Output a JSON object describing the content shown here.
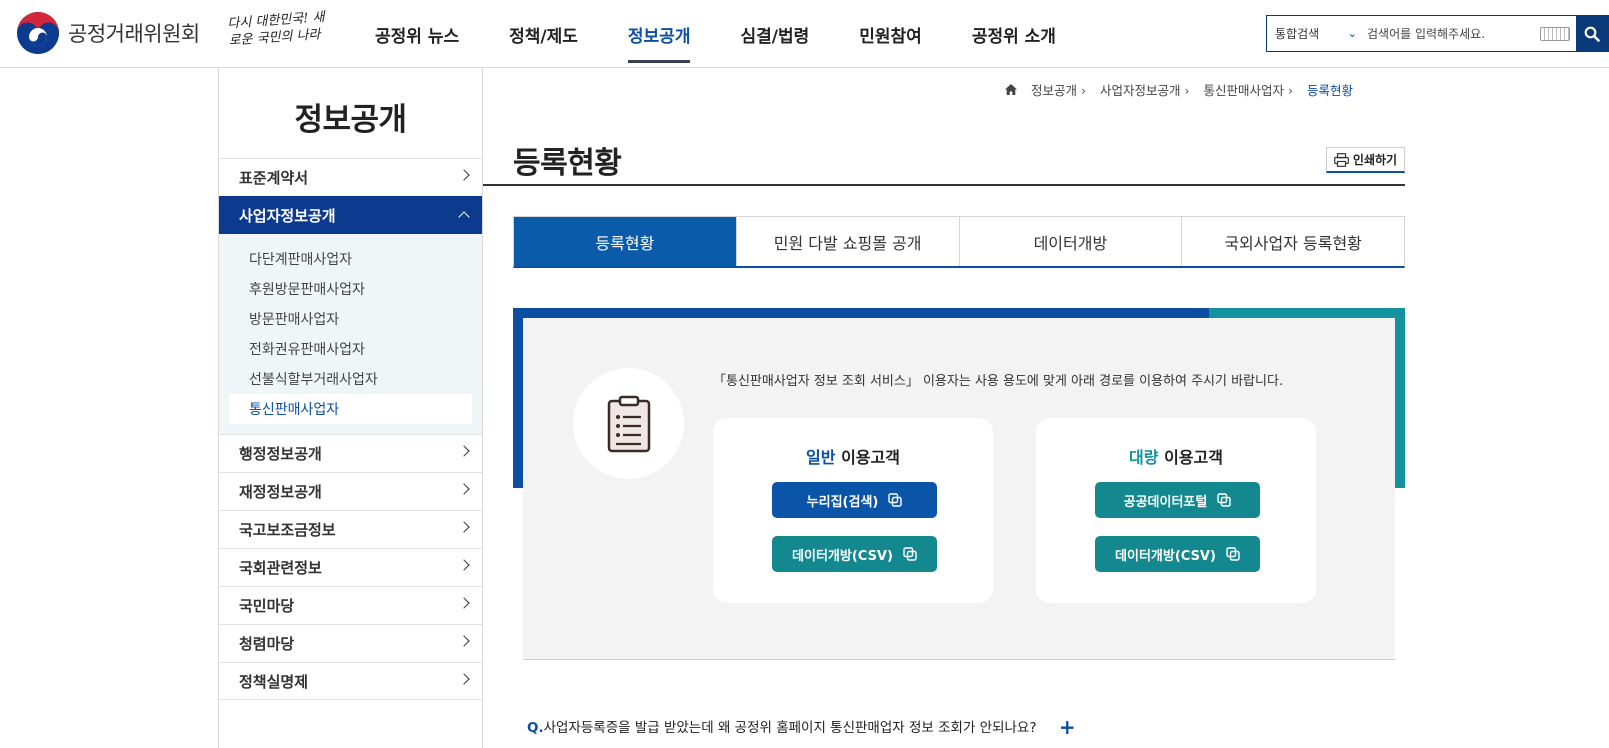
{
  "header": {
    "logo_text": "공정거래위원회",
    "slogan": "다시 대한민국! 새로운 국민의 나라",
    "nav": [
      {
        "label": "공정위 뉴스"
      },
      {
        "label": "정책/제도"
      },
      {
        "label": "정보공개",
        "active": true
      },
      {
        "label": "심결/법령"
      },
      {
        "label": "민원참여"
      },
      {
        "label": "공정위 소개"
      }
    ],
    "search": {
      "scope": "통합검색",
      "placeholder": "검색어를 입력해주세요.",
      "button_icon": "search-icon"
    }
  },
  "sidebar": {
    "title": "정보공개",
    "items": [
      {
        "label": "표준계약서"
      },
      {
        "label": "사업자정보공개",
        "open": true
      },
      {
        "label": "행정정보공개"
      },
      {
        "label": "재정정보공개"
      },
      {
        "label": "국고보조금정보"
      },
      {
        "label": "국회관련정보"
      },
      {
        "label": "국민마당"
      },
      {
        "label": "청렴마당"
      },
      {
        "label": "정책실명제"
      }
    ],
    "sub_items": [
      {
        "label": "다단계판매사업자"
      },
      {
        "label": "후원방문판매사업자"
      },
      {
        "label": "방문판매사업자"
      },
      {
        "label": "전화권유판매사업자"
      },
      {
        "label": "선불식할부거래사업자"
      },
      {
        "label": "통신판매사업자",
        "active": true
      }
    ]
  },
  "breadcrumb": [
    "정보공개",
    "사업자정보공개",
    "통신판매사업자",
    "등록현황"
  ],
  "page": {
    "title": "등록현황",
    "print_label": "인쇄하기"
  },
  "tabs": [
    {
      "label": "등록현황",
      "active": true
    },
    {
      "label": "민원 다발 쇼핑몰 공개"
    },
    {
      "label": "데이터개방"
    },
    {
      "label": "국외사업자 등록현황"
    }
  ],
  "panel": {
    "notice": "「통신판매사업자 정보 조회 서비스」 이용자는 사용 용도에 맞게 아래 경로를 이용하여 주시기 바랍니다.",
    "general": {
      "title_highlight": "일반",
      "title_rest": " 이용고객",
      "buttons": [
        "누리집(검색)",
        "데이터개방(CSV)"
      ]
    },
    "bulk": {
      "title_highlight": "대량",
      "title_rest": " 이용고객",
      "buttons": [
        "공공데이터포털",
        "데이터개방(CSV)"
      ]
    }
  },
  "faq": {
    "q_prefix": "Q.",
    "question": "사업자등록증을 발급 받았는데 왜 공정위 홈페이지 통신판매업자 정보 조회가 안되나요?",
    "toggle": "+"
  },
  "colors": {
    "primary": "#0b4ea2",
    "navy": "#0b3a8f",
    "teal": "#13939f"
  }
}
